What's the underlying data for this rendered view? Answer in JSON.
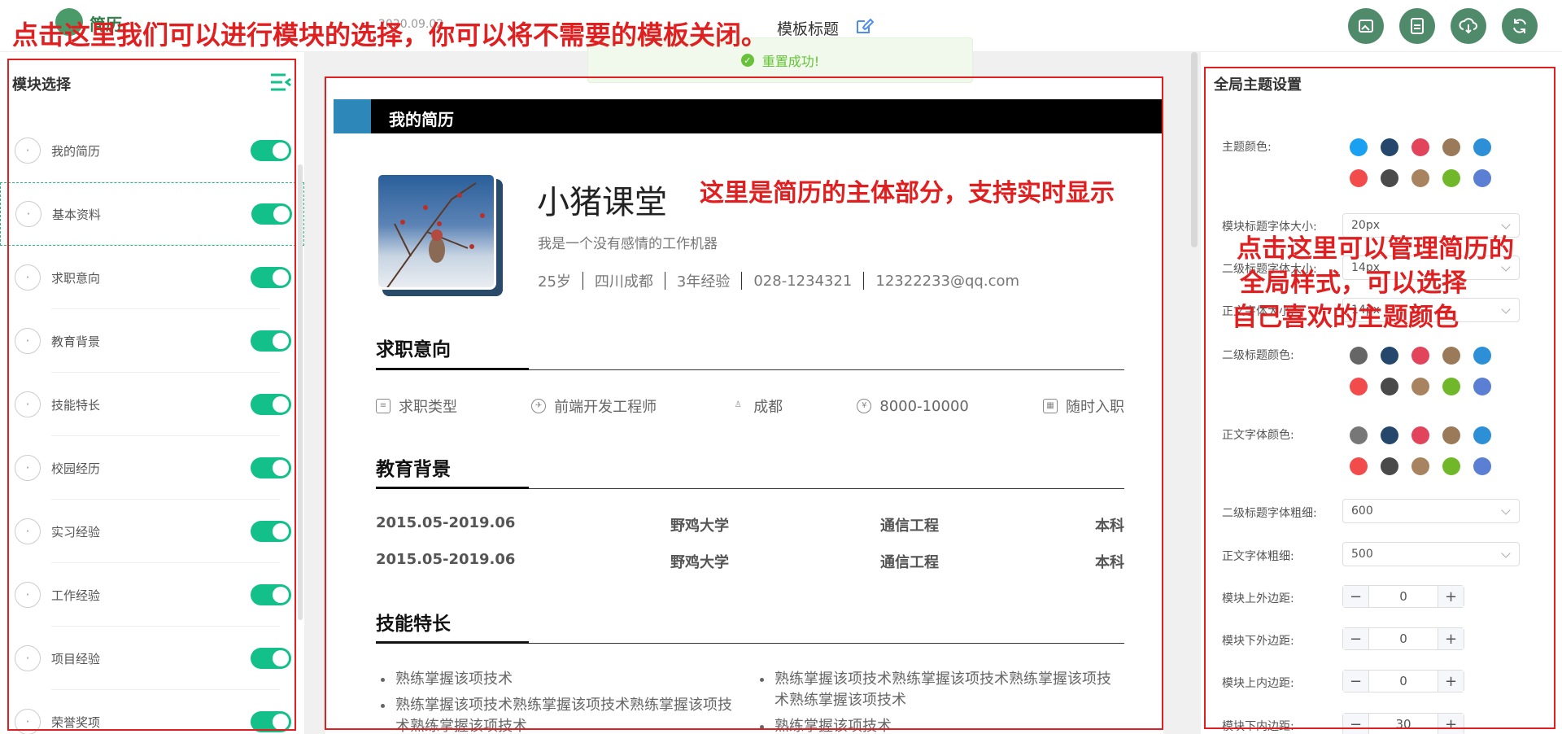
{
  "header": {
    "logo_text": "简历",
    "date": "2020.09.02",
    "template_title": "模板标题",
    "buttons": [
      "export-image",
      "export-pdf",
      "download",
      "refresh"
    ]
  },
  "toast": {
    "message": "重置成功!"
  },
  "annotations": {
    "top": "点击这里我们可以进行模块的选择，你可以将不需要的模板关闭。",
    "middle": "这里是简历的主体部分，支持实时显示",
    "right_line1": "点击这里可以管理简历的",
    "right_line2": "全局样式，可以选择",
    "right_line3": "自己喜欢的主题颜色"
  },
  "left_panel": {
    "title": "模块选择",
    "modules": [
      {
        "label": "我的简历",
        "icon": "list-icon",
        "on": true
      },
      {
        "label": "基本资料",
        "icon": "user-icon",
        "on": true
      },
      {
        "label": "求职意向",
        "icon": "target-icon",
        "on": true
      },
      {
        "label": "教育背景",
        "icon": "graduation-icon",
        "on": true
      },
      {
        "label": "技能特长",
        "icon": "book-icon",
        "on": true
      },
      {
        "label": "校园经历",
        "icon": "campus-icon",
        "on": true
      },
      {
        "label": "实习经验",
        "icon": "intern-icon",
        "on": true
      },
      {
        "label": "工作经验",
        "icon": "briefcase-icon",
        "on": true
      },
      {
        "label": "项目经验",
        "icon": "project-icon",
        "on": true
      },
      {
        "label": "荣誉奖项",
        "icon": "trophy-icon",
        "on": true
      }
    ]
  },
  "resume": {
    "bar_title": "我的简历",
    "name": "小猪课堂",
    "intro": "我是一个没有感情的工作机器",
    "info": [
      "25岁",
      "四川成都",
      "3年经验",
      "028-1234321",
      "12322233@qq.com"
    ],
    "sections": {
      "job": "求职意向",
      "edu": "教育背景",
      "skills": "技能特长"
    },
    "job": [
      "求职类型",
      "前端开发工程师",
      "成都",
      "8000-10000",
      "随时入职"
    ],
    "edu": [
      {
        "date": "2015.05-2019.06",
        "school": "野鸡大学",
        "major": "通信工程",
        "degree": "本科"
      },
      {
        "date": "2015.05-2019.06",
        "school": "野鸡大学",
        "major": "通信工程",
        "degree": "本科"
      }
    ],
    "skills_left": [
      "熟练掌握该项技术",
      "熟练掌握该项技术熟练掌握该项技术熟练掌握该项技术熟练掌握该项技术"
    ],
    "skills_right": [
      "熟练掌握该项技术熟练掌握该项技术熟练掌握该项技术熟练掌握该项技术",
      "熟练掌握该项技术"
    ]
  },
  "right_panel": {
    "title": "全局主题设置",
    "theme_color_label": "主题颜色:",
    "module_title_size_label": "模块标题字体大小:",
    "module_title_size": "20px",
    "sub_title_size_label": "二级标题字体大小:",
    "sub_title_size": "14px",
    "body_size_label": "正文字体大小:",
    "body_size": "14px",
    "sub_title_color_label": "二级标题颜色:",
    "body_color_label": "正文字体颜色:",
    "sub_title_weight_label": "二级标题字体粗细:",
    "sub_title_weight": "600",
    "body_weight_label": "正文字体粗细:",
    "body_weight": "500",
    "margin_top_label": "模块上外边距:",
    "margin_top": "0",
    "margin_bottom_label": "模块下外边距:",
    "margin_bottom": "0",
    "padding_top_label": "模块上内边距:",
    "padding_top": "0",
    "padding_bottom_label": "模块下内边距:",
    "padding_bottom": "30"
  },
  "palette": {
    "theme": [
      "#1aa0f0",
      "#25476b",
      "#e2445c",
      "#9a7a58",
      "#2d8fd5",
      "#f24b4b",
      "#4a4a4a",
      "#a8835f",
      "#70b82a",
      "#5b7fd3"
    ],
    "sub_title": [
      "#666666",
      "#25476b",
      "#e2445c",
      "#9a7a58",
      "#2d8fd5",
      "#f24b4b",
      "#4a4a4a",
      "#a8835f",
      "#70b82a",
      "#5b7fd3"
    ],
    "body": [
      "#777777",
      "#25476b",
      "#e2445c",
      "#9a7a58",
      "#2d8fd5",
      "#f24b4b",
      "#4a4a4a",
      "#a8835f",
      "#70b82a",
      "#5b7fd3"
    ]
  }
}
